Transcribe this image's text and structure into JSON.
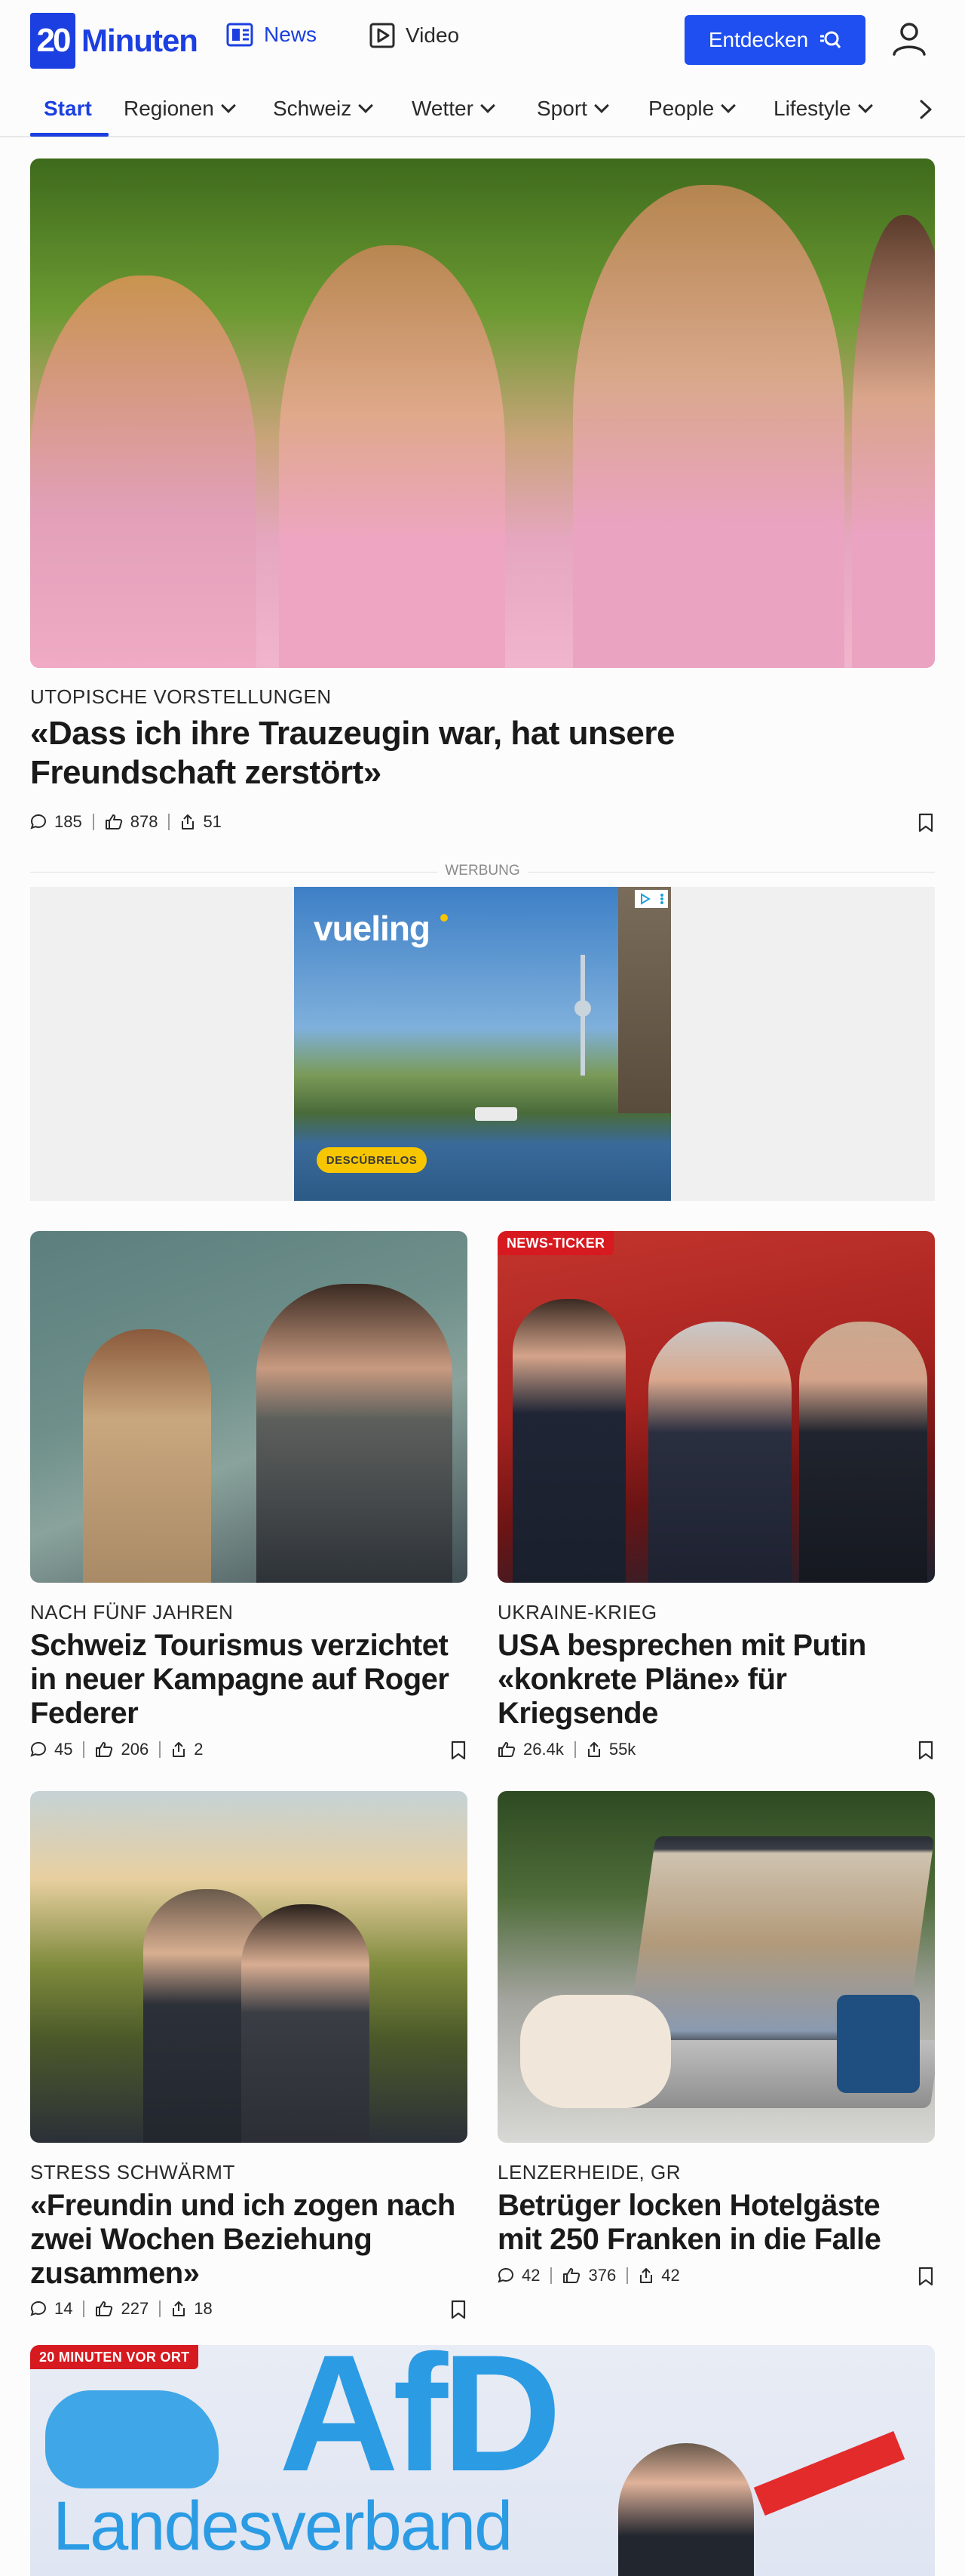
{
  "header": {
    "logo_number": "20",
    "logo_text": "Minuten",
    "nav_news": "News",
    "nav_video": "Video",
    "discover_button": "Entdecken"
  },
  "categories": [
    {
      "label": "Start",
      "active": true
    },
    {
      "label": "Regionen"
    },
    {
      "label": "Schweiz"
    },
    {
      "label": "Wetter"
    },
    {
      "label": "Sport"
    },
    {
      "label": "People"
    },
    {
      "label": "Lifestyle"
    }
  ],
  "hero": {
    "kicker": "UTOPISCHE VORSTELLUNGEN",
    "headline": "«Dass ich ihre Trauzeugin war, hat unsere Freundschaft zerstört»",
    "comments": "185",
    "likes": "878",
    "shares": "51"
  },
  "ad": {
    "label": "WERBUNG",
    "brand": "vueling",
    "cta": "DESCÚBRELOS"
  },
  "articles": [
    {
      "kicker": "NACH FÜNF JAHREN",
      "headline": "Schweiz Tourismus verzichtet in neuer Kampagne auf Roger Federer",
      "comments": "45",
      "likes": "206",
      "shares": "2"
    },
    {
      "tag": "NEWS-TICKER",
      "kicker": "UKRAINE-KRIEG",
      "headline": "USA besprechen mit Putin «konkrete Pläne» für Kriegsende",
      "likes": "26.4k",
      "shares": "55k"
    },
    {
      "kicker": "STRESS SCHWÄRMT",
      "headline": "«Freundin und ich zogen nach zwei Wochen Beziehung zusammen»",
      "comments": "14",
      "likes": "227",
      "shares": "18"
    },
    {
      "kicker": "LENZERHEIDE, GR",
      "headline": "Betrüger locken Hotelgäste mit 250 Franken in die Falle",
      "comments": "42",
      "likes": "376",
      "shares": "42"
    },
    {
      "tag": "20 MINUTEN VOR ORT",
      "image_text_1": "AfD",
      "image_text_2": "Landesverband"
    }
  ],
  "icons": {
    "news": "newspaper-icon",
    "video": "play-icon",
    "discover": "search-icon",
    "user": "user-icon",
    "comment": "comment-icon",
    "like": "thumbs-up-icon",
    "share": "share-icon",
    "bookmark": "bookmark-icon",
    "chevron": "chevron-down-icon",
    "next": "chevron-right-icon"
  },
  "colors": {
    "brand": "#1b3fe0",
    "button": "#1f4ff0",
    "tag": "#d71920"
  }
}
